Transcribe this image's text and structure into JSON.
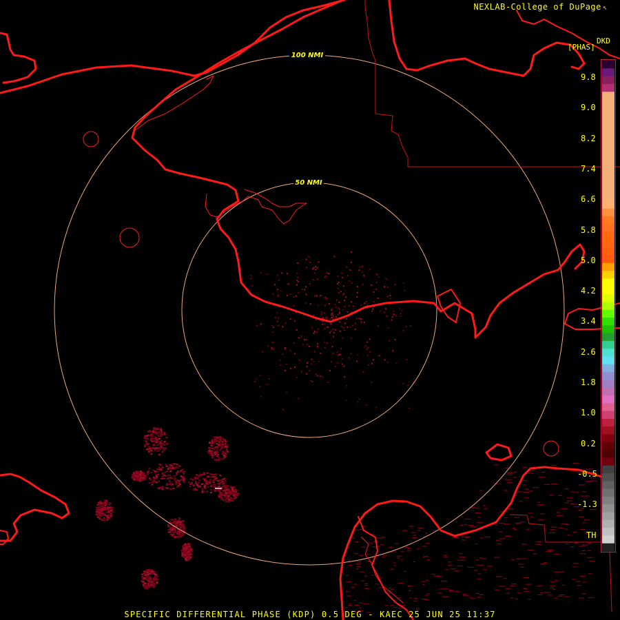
{
  "header": {
    "credit": "NEXLAB-College of DuPage",
    "credit_mark": "↖",
    "product_code": "DKD",
    "unit": "[PHAS]"
  },
  "rings": [
    {
      "label": "100 NMI"
    },
    {
      "label": "50 NMI"
    }
  ],
  "scale": {
    "labels": [
      "9.8",
      "9.0",
      "8.2",
      "7.4",
      "6.6",
      "5.8",
      "5.0",
      "4.2",
      "3.4",
      "2.6",
      "1.8",
      "1.0",
      "0.2",
      "-0.5",
      "-1.3",
      "TH"
    ],
    "colors": [
      "#2a0030",
      "#6a1a7a",
      "#8a2060",
      "#b03070",
      "#f5b07a",
      "#f5b07a",
      "#f5b07a",
      "#f5b07a",
      "#f5b07a",
      "#f5b07a",
      "#f5b07a",
      "#f5b07a",
      "#f5b07a",
      "#f5b07a",
      "#f5b07a",
      "#f5b07a",
      "#f5b07a",
      "#f5b07a",
      "#ffb070",
      "#ff9040",
      "#ff7a20",
      "#ff7020",
      "#ff6a10",
      "#ff6810",
      "#ff6010",
      "#ff5a10",
      "#ffa000",
      "#ffd000",
      "#ffff00",
      "#ffff00",
      "#e0ff00",
      "#b0ff00",
      "#60ff00",
      "#30e000",
      "#20c000",
      "#20a030",
      "#30d090",
      "#50e0d0",
      "#60e0f0",
      "#80b0e0",
      "#9090d0",
      "#a080c0",
      "#c070b0",
      "#e070c0",
      "#e06090",
      "#d04070",
      "#c02040",
      "#a01020",
      "#800010",
      "#600008",
      "#500000",
      "#700010",
      "#404040",
      "#505050",
      "#606060",
      "#707070",
      "#808080",
      "#909090",
      "#a0a0a0",
      "#b0b0b0",
      "#c0c0c0",
      "#d0d0d0",
      "#202020"
    ]
  },
  "caption": "SPECIFIC DIFFERENTIAL PHASE (KDP) 0.5 DEG - KAEC 25 JUN 25 11:37",
  "colors": {
    "coastline": "#ff1a1a",
    "boundary": "#d01010",
    "range_ring": "#f0a878",
    "echo_dark": "#7a0018",
    "echo_mid": "#a01028",
    "text": "#ffff00"
  }
}
